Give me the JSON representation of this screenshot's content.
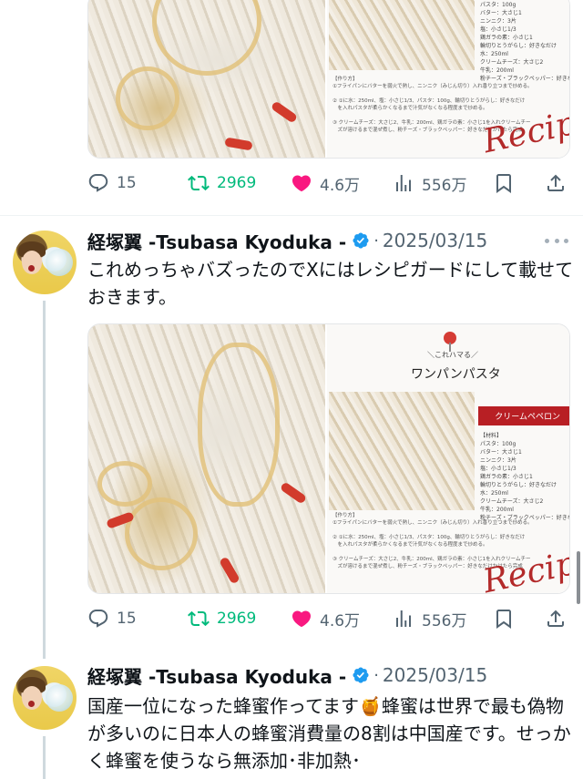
{
  "tweets": [
    {
      "partial": true,
      "stats": {
        "replies": "15",
        "retweets": "2969",
        "likes": "4.6万",
        "views": "556万"
      },
      "image": {
        "recipe_ingredients": "パスタ：100g\nバター：大さじ1\nニンニク：3片\n塩：小さじ1/3\n鶏ガラの素：小さじ1\n輪切りとうがらし：好きなだけ\n水：250ml\nクリームチーズ：大さじ2\n牛乳：200ml\n粉チーズ・ブラックペッパー：好きな",
        "recipe_steps": "【作り方】\n①フライパンにバターを弱火で熱し、ニンニク（みじん切り）入れ香り立つまで炒める。\n\n② ①に水：250ml、塩：小さじ1/3、パスタ：100g、輪切りとうがらし：好きなだけ\n　を入れパスタが柔らかくなるまで汁気がなくなる程度まで炒める。\n\n③ クリームチーズ：大さじ2、牛乳：200ml、鶏ガラの素：小さじ1を入れクリームチー\n　ズが溶けるまで混ぜ煮し、粉チーズ・ブラックペッパー：好きなだけかけたら完成",
        "recipe_sign": "Recip"
      }
    },
    {
      "name": "経塚翼 -Tsubasa Kyoduka -",
      "date": "2025/03/15",
      "separator": "·",
      "text": "これめっちゃバズったのでXにはレシピガードにして載せておきます。",
      "stats": {
        "replies": "15",
        "retweets": "2969",
        "likes": "4.6万",
        "views": "556万"
      },
      "image": {
        "tag": "＼これハマる／",
        "title": "ワンパンパスタ",
        "ribbon": "クリームペペロン",
        "recipe_ingredients": "【材料】\nパスタ：100g\nバター：大さじ1\nニンニク：3片\n塩：小さじ1/3\n鶏ガラの素：小さじ1\n輪切りとうがらし：好きなだけ\n水：250ml\nクリームチーズ：大さじ2\n牛乳：200ml\n粉チーズ・ブラックペッパー：好きな",
        "recipe_steps": "【作り方】\n①フライパンにバターを弱火で熱し、ニンニク（みじん切り）入れ香り立つまで炒める。\n\n② ①に水：250ml、塩：小さじ1/3、パスタ：100g、輪切りとうがらし：好きなだけ\n　を入れパスタが柔らかくなるまで汁気がなくなる程度まで炒める。\n\n③ クリームチーズ：大さじ2、牛乳：200ml、鶏ガラの素：小さじ1を入れクリームチー\n　ズが溶けるまで混ぜ煮し、粉チーズ・ブラックペッパー：好きなだけかけたら完成",
        "recipe_sign": "Recip"
      }
    },
    {
      "name": "経塚翼 -Tsubasa Kyoduka -",
      "date": "2025/03/15",
      "separator": "·",
      "text": "国産一位になった蜂蜜作ってます🍯蜂蜜は世界で最も偽物が多いのに日本人の蜂蜜消費量の8割は中国産です。せっかく蜂蜜を使うなら無添加･非加熱･"
    }
  ],
  "colors": {
    "retweet": "#00ba7c",
    "like": "#f91880",
    "muted": "#536471",
    "verified": "#1d9bf0"
  },
  "icons": {
    "reply": "reply-icon",
    "retweet": "retweet-icon",
    "like": "heart-icon",
    "views": "views-icon",
    "bookmark": "bookmark-icon",
    "share": "share-icon",
    "more": "more-icon",
    "verified": "verified-badge-icon"
  }
}
